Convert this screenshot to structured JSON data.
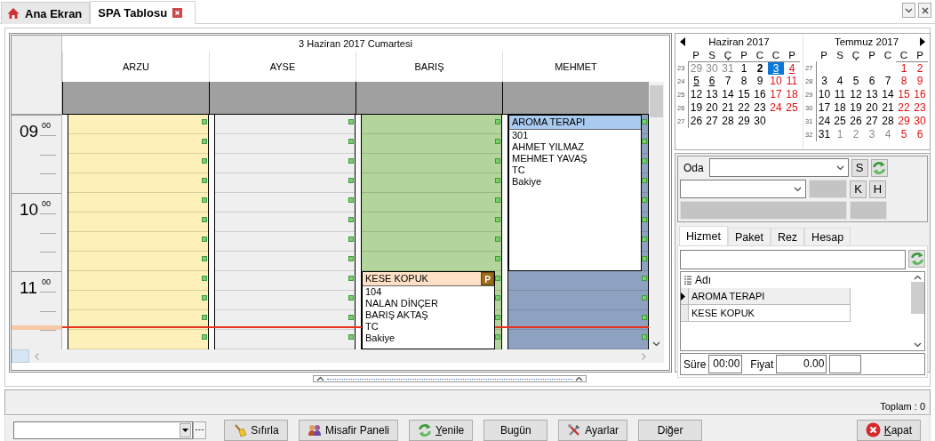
{
  "tabs": [
    {
      "label": "Ana Ekran",
      "kind": "home",
      "selected": false
    },
    {
      "label": "SPA Tablosu",
      "kind": "closable",
      "selected": true
    }
  ],
  "schedule": {
    "date": "3 Haziran 2017 Cumartesi",
    "hours": [
      {
        "hour": "09",
        "minute": "00"
      },
      {
        "hour": "10",
        "minute": "00"
      },
      {
        "hour": "11",
        "minute": "00"
      }
    ],
    "resources": [
      {
        "name": "ARZU",
        "color": "#fdf0b8",
        "hours": [
          {
            "kind": "free"
          },
          {
            "kind": "free"
          },
          {
            "kind": "free"
          }
        ]
      },
      {
        "name": "AYSE",
        "color": "#efefef",
        "hours": [
          {
            "kind": "free"
          },
          {
            "kind": "free"
          },
          {
            "kind": "free"
          }
        ]
      },
      {
        "name": "BARIŞ",
        "color": "#b3d59b",
        "hours": [
          {
            "kind": "free"
          },
          {
            "kind": "free"
          },
          {
            "kind": "appointment",
            "title": "KESE KOPUK",
            "badge": "P",
            "color": "#fde0c6",
            "lines": [
              "104",
              "NALAN DİNÇER",
              "BARIŞ AKTAŞ",
              "TC",
              "Bakiye"
            ]
          }
        ]
      },
      {
        "name": "MEHMET",
        "color": "#8fa1c1",
        "hours": [
          {
            "kind": "appointment",
            "title": "AROMA TERAPI",
            "color": "#a9cbf0",
            "lines": [
              "301",
              "AHMET YILMAZ",
              "MEHMET YAVAŞ",
              "TC",
              "Bakiye"
            ]
          },
          {
            "kind": "continued"
          },
          {
            "kind": "free"
          }
        ]
      }
    ]
  },
  "calendar": {
    "months": [
      {
        "title": "Haziran 2017",
        "weekdays": [
          "P",
          "S",
          "Ç",
          "P",
          "C",
          "C",
          "P"
        ],
        "weeks": [
          {
            "number": "23",
            "days": [
              {
                "day": "29",
                "kind": "other",
                "selected": false
              },
              {
                "day": "30",
                "kind": "other",
                "selected": false
              },
              {
                "day": "31",
                "kind": "other",
                "selected": false
              },
              {
                "day": "1",
                "kind": "day",
                "selected": false
              },
              {
                "day": "2",
                "kind": "today",
                "selected": false
              },
              {
                "day": "3",
                "kind": "marked-weekend",
                "selected": true
              },
              {
                "day": "4",
                "kind": "marked-weekend",
                "selected": false
              }
            ]
          },
          {
            "number": "24",
            "days": [
              {
                "day": "5",
                "kind": "marked",
                "selected": false
              },
              {
                "day": "6",
                "kind": "marked",
                "selected": false
              },
              {
                "day": "7",
                "kind": "day",
                "selected": false
              },
              {
                "day": "8",
                "kind": "day",
                "selected": false
              },
              {
                "day": "9",
                "kind": "day",
                "selected": false
              },
              {
                "day": "10",
                "kind": "weekend",
                "selected": false
              },
              {
                "day": "11",
                "kind": "weekend",
                "selected": false
              }
            ]
          },
          {
            "number": "25",
            "days": [
              {
                "day": "12",
                "kind": "day",
                "selected": false
              },
              {
                "day": "13",
                "kind": "day",
                "selected": false
              },
              {
                "day": "14",
                "kind": "day",
                "selected": false
              },
              {
                "day": "15",
                "kind": "day",
                "selected": false
              },
              {
                "day": "16",
                "kind": "day",
                "selected": false
              },
              {
                "day": "17",
                "kind": "weekend",
                "selected": false
              },
              {
                "day": "18",
                "kind": "weekend",
                "selected": false
              }
            ]
          },
          {
            "number": "26",
            "days": [
              {
                "day": "19",
                "kind": "day",
                "selected": false
              },
              {
                "day": "20",
                "kind": "day",
                "selected": false
              },
              {
                "day": "21",
                "kind": "day",
                "selected": false
              },
              {
                "day": "22",
                "kind": "day",
                "selected": false
              },
              {
                "day": "23",
                "kind": "day",
                "selected": false
              },
              {
                "day": "24",
                "kind": "weekend",
                "selected": false
              },
              {
                "day": "25",
                "kind": "weekend",
                "selected": false
              }
            ]
          },
          {
            "number": "27",
            "days": [
              {
                "day": "26",
                "kind": "day",
                "selected": false
              },
              {
                "day": "27",
                "kind": "day",
                "selected": false
              },
              {
                "day": "28",
                "kind": "day",
                "selected": false
              },
              {
                "day": "29",
                "kind": "day",
                "selected": false
              },
              {
                "day": "30",
                "kind": "day",
                "selected": false
              },
              {
                "kind": "blank"
              },
              {
                "kind": "blank"
              }
            ]
          }
        ]
      },
      {
        "title": "Temmuz 2017",
        "weekdays": [
          "P",
          "S",
          "Ç",
          "P",
          "C",
          "C",
          "P"
        ],
        "weeks": [
          {
            "number": "27",
            "days": [
              {
                "kind": "blank"
              },
              {
                "kind": "blank"
              },
              {
                "kind": "blank"
              },
              {
                "kind": "blank"
              },
              {
                "kind": "blank"
              },
              {
                "day": "1",
                "kind": "weekend",
                "selected": false
              },
              {
                "day": "2",
                "kind": "weekend",
                "selected": false
              }
            ]
          },
          {
            "number": "28",
            "days": [
              {
                "day": "3",
                "kind": "day",
                "selected": false
              },
              {
                "day": "4",
                "kind": "day",
                "selected": false
              },
              {
                "day": "5",
                "kind": "day",
                "selected": false
              },
              {
                "day": "6",
                "kind": "day",
                "selected": false
              },
              {
                "day": "7",
                "kind": "day",
                "selected": false
              },
              {
                "day": "8",
                "kind": "weekend",
                "selected": false
              },
              {
                "day": "9",
                "kind": "weekend",
                "selected": false
              }
            ]
          },
          {
            "number": "29",
            "days": [
              {
                "day": "10",
                "kind": "day",
                "selected": false
              },
              {
                "day": "11",
                "kind": "day",
                "selected": false
              },
              {
                "day": "12",
                "kind": "day",
                "selected": false
              },
              {
                "day": "13",
                "kind": "day",
                "selected": false
              },
              {
                "day": "14",
                "kind": "day",
                "selected": false
              },
              {
                "day": "15",
                "kind": "weekend",
                "selected": false
              },
              {
                "day": "16",
                "kind": "weekend",
                "selected": false
              }
            ]
          },
          {
            "number": "30",
            "days": [
              {
                "day": "17",
                "kind": "day",
                "selected": false
              },
              {
                "day": "18",
                "kind": "day",
                "selected": false
              },
              {
                "day": "19",
                "kind": "day",
                "selected": false
              },
              {
                "day": "20",
                "kind": "day",
                "selected": false
              },
              {
                "day": "21",
                "kind": "day",
                "selected": false
              },
              {
                "day": "22",
                "kind": "weekend",
                "selected": false
              },
              {
                "day": "23",
                "kind": "weekend",
                "selected": false
              }
            ]
          },
          {
            "number": "31",
            "days": [
              {
                "day": "24",
                "kind": "day",
                "selected": false
              },
              {
                "day": "25",
                "kind": "day",
                "selected": false
              },
              {
                "day": "26",
                "kind": "day",
                "selected": false
              },
              {
                "day": "27",
                "kind": "day",
                "selected": false
              },
              {
                "day": "28",
                "kind": "day",
                "selected": false
              },
              {
                "day": "29",
                "kind": "weekend",
                "selected": false
              },
              {
                "day": "30",
                "kind": "weekend",
                "selected": false
              }
            ]
          },
          {
            "number": "32",
            "days": [
              {
                "day": "31",
                "kind": "day",
                "selected": false
              },
              {
                "day": "1",
                "kind": "other",
                "selected": false
              },
              {
                "day": "2",
                "kind": "other",
                "selected": false
              },
              {
                "day": "3",
                "kind": "other",
                "selected": false
              },
              {
                "day": "4",
                "kind": "other",
                "selected": false
              },
              {
                "day": "5",
                "kind": "other-weekend",
                "selected": false
              },
              {
                "day": "6",
                "kind": "other-weekend",
                "selected": false
              }
            ]
          }
        ]
      }
    ]
  },
  "booking_panel": {
    "room_label": "Oda",
    "letter_buttons": [
      "S",
      "K",
      "H"
    ],
    "tabs": [
      {
        "label": "Hizmet",
        "selected": true
      },
      {
        "label": "Paket",
        "selected": false
      },
      {
        "label": "Rez",
        "selected": false
      },
      {
        "label": "Hesap",
        "selected": false
      }
    ],
    "service_list": {
      "column": "Adı",
      "rows": [
        {
          "name": "AROMA TERAPI",
          "selected": true
        },
        {
          "name": "KESE KOPUK",
          "selected": false
        }
      ]
    },
    "duration": {
      "label": "Süre",
      "value": "00:00"
    },
    "price": {
      "label": "Fiyat",
      "value": "0.00"
    }
  },
  "status_bar": {
    "total": "Toplam : 0"
  },
  "toolbar": {
    "buttons": [
      {
        "label": "Sıfırla",
        "kind": "reset",
        "mnemonic": false
      },
      {
        "label": "Misafir Paneli",
        "kind": "guests",
        "mnemonic": false
      },
      {
        "label": "Yenile",
        "kind": "refresh",
        "mnemonic": true
      },
      {
        "label": "Bugün",
        "kind": "plain",
        "mnemonic": false
      },
      {
        "label": "Ayarlar",
        "kind": "settings",
        "mnemonic": false
      },
      {
        "label": "Diğer",
        "kind": "plain",
        "mnemonic": false
      },
      {
        "label": "Kapat",
        "kind": "close",
        "mnemonic": true
      }
    ]
  }
}
